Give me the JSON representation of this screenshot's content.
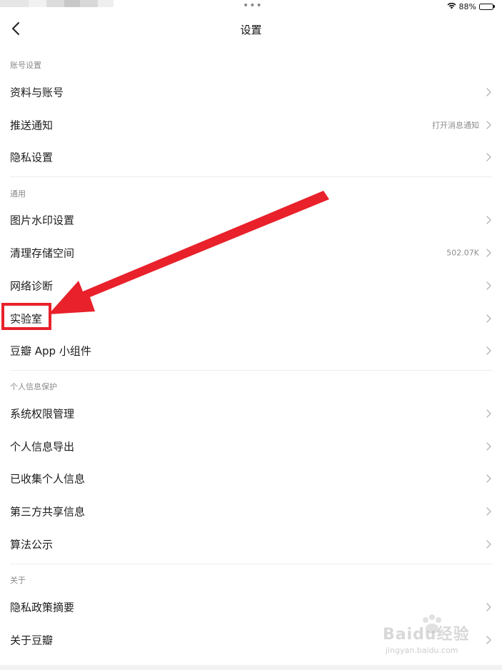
{
  "status_bar": {
    "dots": "•••",
    "battery_percent": "88%",
    "battery_level": 0.88
  },
  "nav": {
    "title": "设置"
  },
  "sections": [
    {
      "header": "账号设置",
      "items": [
        {
          "label": "资料与账号",
          "detail": ""
        },
        {
          "label": "推送通知",
          "detail": "打开消息通知"
        },
        {
          "label": "隐私设置",
          "detail": ""
        }
      ]
    },
    {
      "header": "通用",
      "items": [
        {
          "label": "图片水印设置",
          "detail": ""
        },
        {
          "label": "清理存储空间",
          "detail": "502.07K"
        },
        {
          "label": "网络诊断",
          "detail": ""
        },
        {
          "label": "实验室",
          "detail": ""
        },
        {
          "label": "豆瓣 App 小组件",
          "detail": ""
        }
      ]
    },
    {
      "header": "个人信息保护",
      "items": [
        {
          "label": "系统权限管理",
          "detail": ""
        },
        {
          "label": "个人信息导出",
          "detail": ""
        },
        {
          "label": "已收集个人信息",
          "detail": ""
        },
        {
          "label": "第三方共享信息",
          "detail": ""
        },
        {
          "label": "算法公示",
          "detail": ""
        }
      ]
    },
    {
      "header": "关于",
      "items": [
        {
          "label": "隐私政策摘要",
          "detail": ""
        },
        {
          "label": "关于豆瓣",
          "detail": ""
        }
      ]
    }
  ],
  "annotation": {
    "color": "#e8212b"
  },
  "watermark": {
    "brand": "Baidu经验",
    "url": "jingyan.baidu.com"
  }
}
